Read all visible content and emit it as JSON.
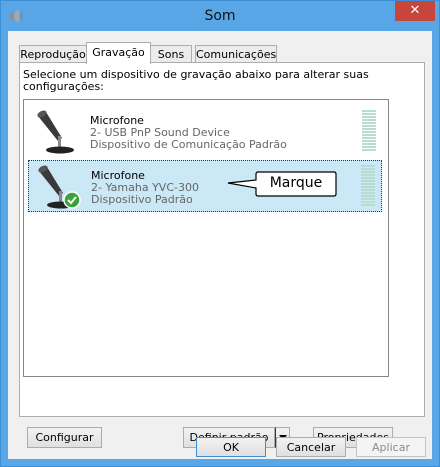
{
  "window": {
    "title": "Som",
    "close_glyph": "✕",
    "icon": "speaker-icon"
  },
  "tabs": [
    {
      "label": "Reprodução",
      "active": false
    },
    {
      "label": "Gravação",
      "active": true
    },
    {
      "label": "Sons",
      "active": false
    },
    {
      "label": "Comunicações",
      "active": false
    }
  ],
  "instructions": "Selecione um dispositivo de gravação abaixo para alterar suas configurações:",
  "devices": [
    {
      "name": "Microfone",
      "description": "2- USB PnP Sound Device",
      "status": "Dispositivo de Comunicação Padrão",
      "selected": false,
      "icon": "microphone-icon"
    },
    {
      "name": "Microfone",
      "description": "2- Yamaha YVC-300",
      "status": "Dispositivo Padrão",
      "selected": true,
      "icon": "microphone-icon",
      "badge": "checkmark-icon"
    }
  ],
  "callout": {
    "text": "Marque"
  },
  "buttons": {
    "configure": "Configurar",
    "set_default": "Definir padrão",
    "properties": "Propriedades",
    "ok": "OK",
    "cancel": "Cancelar",
    "apply": "Aplicar"
  },
  "colors": {
    "titlebar": "#59a6e6",
    "close": "#c7453b",
    "selection": "#cbe8f6",
    "check": "#3aa23a"
  }
}
